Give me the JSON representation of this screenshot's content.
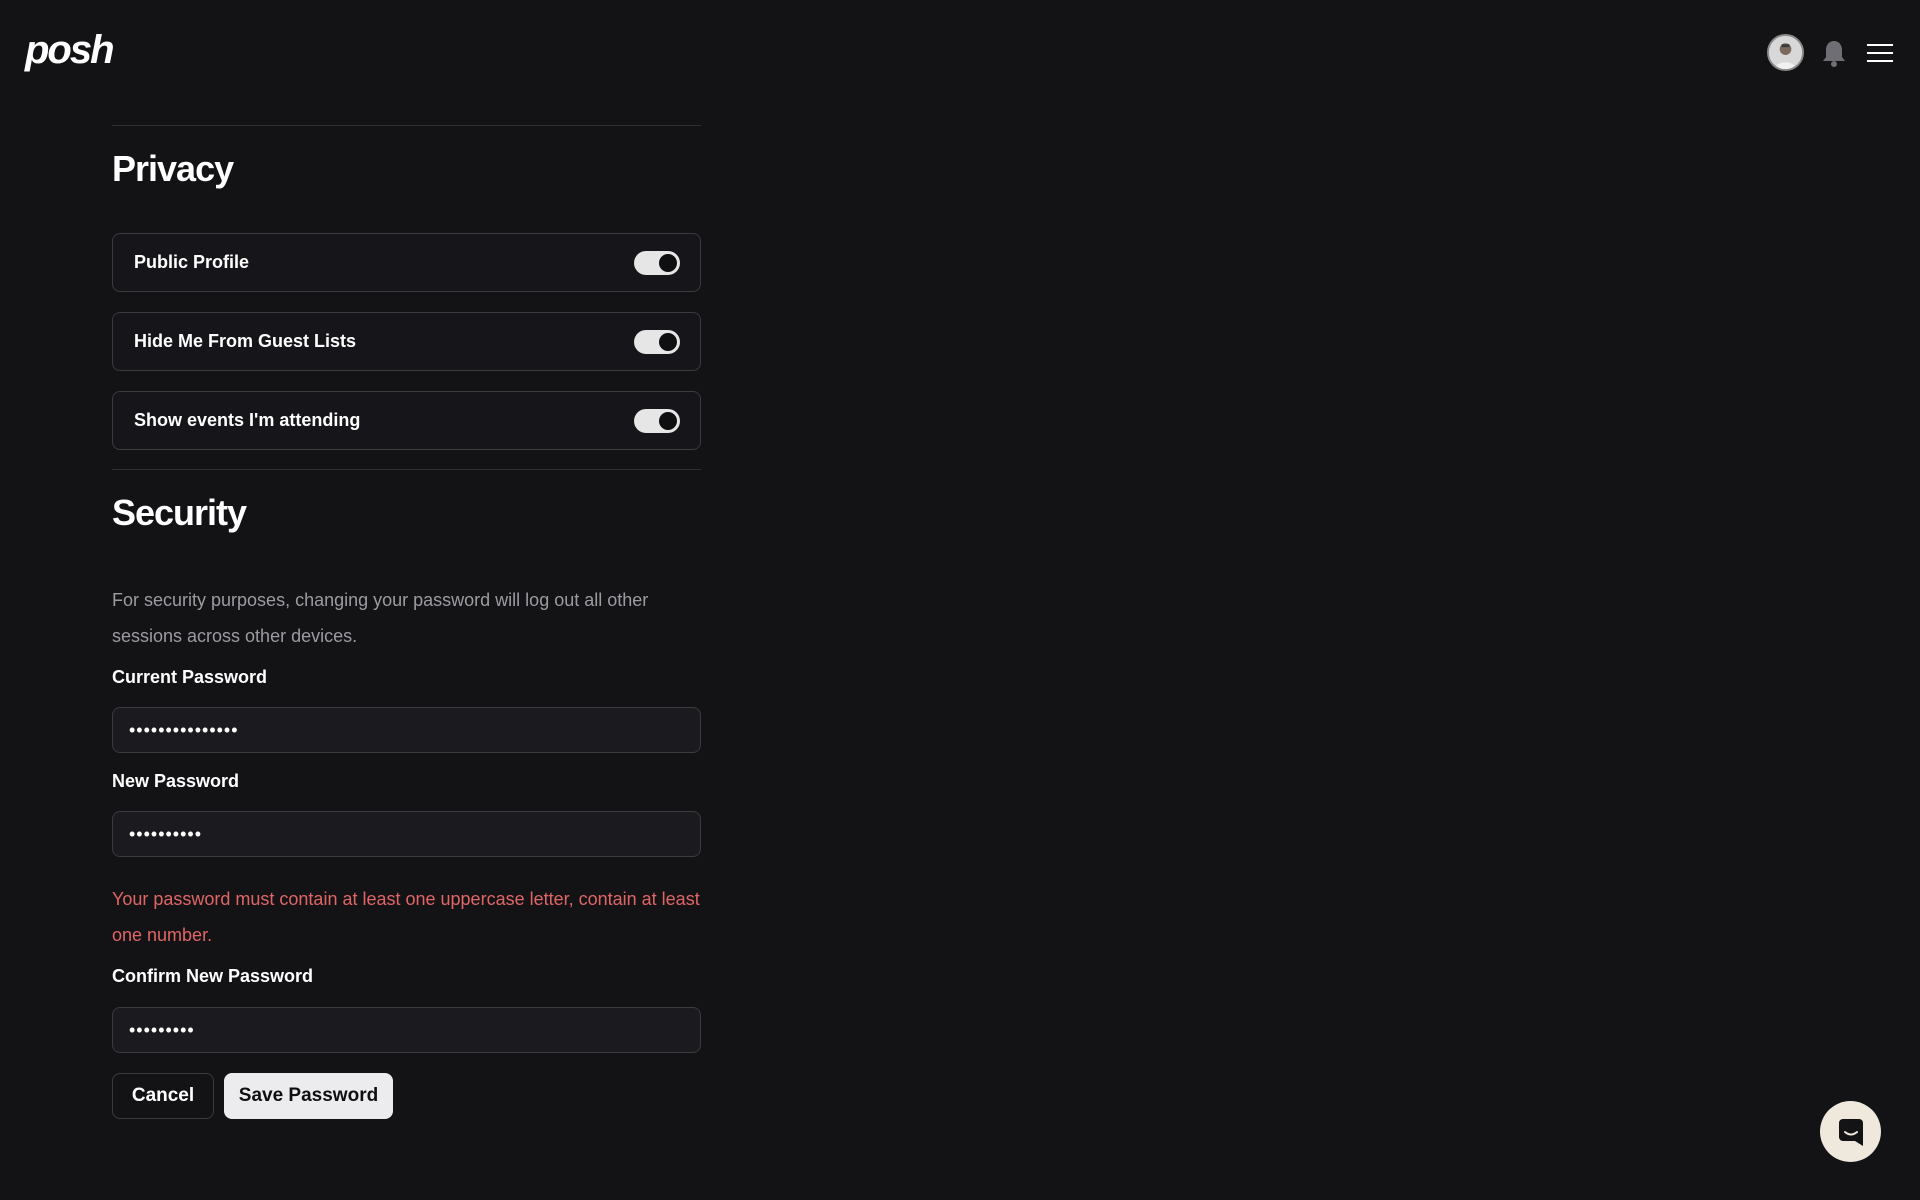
{
  "header": {
    "logo_text": "posh",
    "icons": {
      "avatar": "user-avatar",
      "notifications": "bell-icon",
      "menu": "hamburger-menu-icon"
    }
  },
  "privacy": {
    "title": "Privacy",
    "toggles": [
      {
        "label": "Public Profile",
        "on": true
      },
      {
        "label": "Hide Me From Guest Lists",
        "on": true
      },
      {
        "label": "Show events I'm attending",
        "on": true
      }
    ]
  },
  "security": {
    "title": "Security",
    "description": "For security purposes, changing your password will log out all other sessions across other devices.",
    "current_password": {
      "label": "Current Password",
      "value": "•••••••••••••••"
    },
    "new_password": {
      "label": "New Password",
      "value": "••••••••••"
    },
    "error": "Your password must contain at least one uppercase letter, contain at least one number.",
    "confirm_password": {
      "label": "Confirm New Password",
      "value": "•••••••••"
    },
    "cancel_label": "Cancel",
    "save_label": "Save Password"
  },
  "support": {
    "icon": "chat-icon"
  },
  "colors": {
    "background": "#131316",
    "error": "#e06666",
    "save_button": "#ececee",
    "chat_bubble": "#efe8dd"
  }
}
